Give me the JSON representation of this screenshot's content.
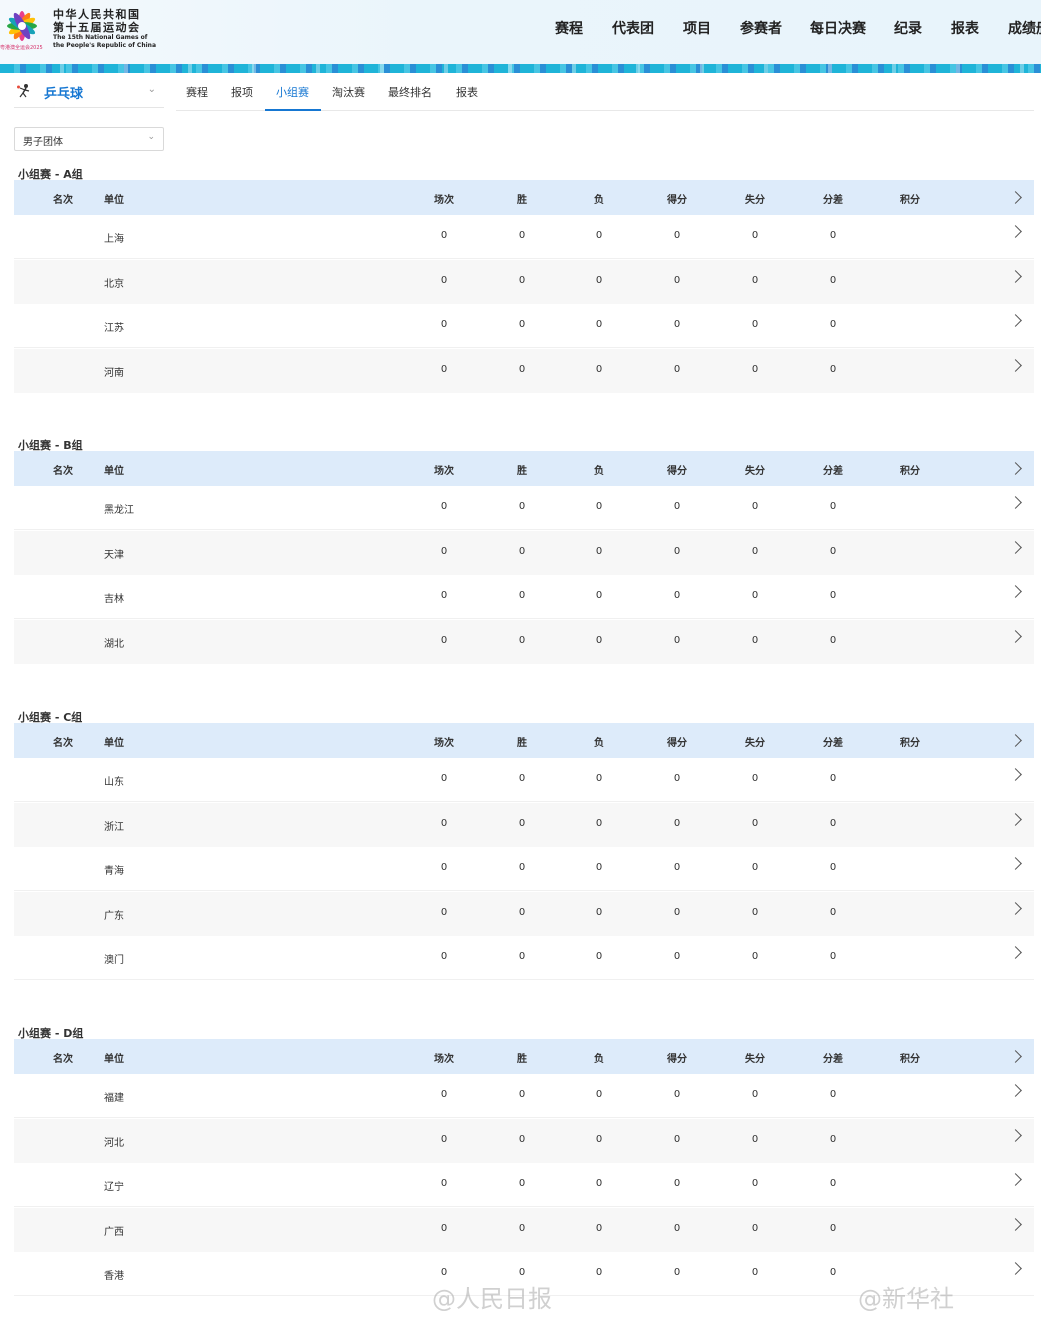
{
  "header": {
    "logo_cn_line1": "中华人民共和国",
    "logo_cn_line2": "第十五届运动会",
    "logo_en_line1": "The 15th National Games of",
    "logo_en_line2": "the People's Republic of China",
    "logo_sub": "粤港澳全运会2025",
    "nav": [
      "赛程",
      "代表团",
      "项目",
      "参赛者",
      "每日决赛",
      "纪录",
      "报表",
      "成绩册"
    ]
  },
  "sport": {
    "label": "乒乓球",
    "icon": "table-tennis-icon"
  },
  "tabs": [
    "赛程",
    "报项",
    "小组赛",
    "淘汰赛",
    "最终排名",
    "报表"
  ],
  "active_tab": "小组赛",
  "event_select": {
    "value": "男子团体"
  },
  "columns": [
    "名次",
    "单位",
    "场次",
    "胜",
    "负",
    "得分",
    "失分",
    "分差",
    "积分"
  ],
  "groups": [
    {
      "title": "小组赛 - A组",
      "rows": [
        {
          "rank": "",
          "team": "上海",
          "played": "0",
          "won": "0",
          "lost": "0",
          "scored": "0",
          "conceded": "0",
          "diff": "0",
          "points": ""
        },
        {
          "rank": "",
          "team": "北京",
          "played": "0",
          "won": "0",
          "lost": "0",
          "scored": "0",
          "conceded": "0",
          "diff": "0",
          "points": ""
        },
        {
          "rank": "",
          "team": "江苏",
          "played": "0",
          "won": "0",
          "lost": "0",
          "scored": "0",
          "conceded": "0",
          "diff": "0",
          "points": ""
        },
        {
          "rank": "",
          "team": "河南",
          "played": "0",
          "won": "0",
          "lost": "0",
          "scored": "0",
          "conceded": "0",
          "diff": "0",
          "points": ""
        }
      ]
    },
    {
      "title": "小组赛 - B组",
      "rows": [
        {
          "rank": "",
          "team": "黑龙江",
          "played": "0",
          "won": "0",
          "lost": "0",
          "scored": "0",
          "conceded": "0",
          "diff": "0",
          "points": ""
        },
        {
          "rank": "",
          "team": "天津",
          "played": "0",
          "won": "0",
          "lost": "0",
          "scored": "0",
          "conceded": "0",
          "diff": "0",
          "points": ""
        },
        {
          "rank": "",
          "team": "吉林",
          "played": "0",
          "won": "0",
          "lost": "0",
          "scored": "0",
          "conceded": "0",
          "diff": "0",
          "points": ""
        },
        {
          "rank": "",
          "team": "湖北",
          "played": "0",
          "won": "0",
          "lost": "0",
          "scored": "0",
          "conceded": "0",
          "diff": "0",
          "points": ""
        }
      ]
    },
    {
      "title": "小组赛 - C组",
      "rows": [
        {
          "rank": "",
          "team": "山东",
          "played": "0",
          "won": "0",
          "lost": "0",
          "scored": "0",
          "conceded": "0",
          "diff": "0",
          "points": ""
        },
        {
          "rank": "",
          "team": "浙江",
          "played": "0",
          "won": "0",
          "lost": "0",
          "scored": "0",
          "conceded": "0",
          "diff": "0",
          "points": ""
        },
        {
          "rank": "",
          "team": "青海",
          "played": "0",
          "won": "0",
          "lost": "0",
          "scored": "0",
          "conceded": "0",
          "diff": "0",
          "points": ""
        },
        {
          "rank": "",
          "team": "广东",
          "played": "0",
          "won": "0",
          "lost": "0",
          "scored": "0",
          "conceded": "0",
          "diff": "0",
          "points": ""
        },
        {
          "rank": "",
          "team": "澳门",
          "played": "0",
          "won": "0",
          "lost": "0",
          "scored": "0",
          "conceded": "0",
          "diff": "0",
          "points": ""
        }
      ]
    },
    {
      "title": "小组赛 - D组",
      "rows": [
        {
          "rank": "",
          "team": "福建",
          "played": "0",
          "won": "0",
          "lost": "0",
          "scored": "0",
          "conceded": "0",
          "diff": "0",
          "points": ""
        },
        {
          "rank": "",
          "team": "河北",
          "played": "0",
          "won": "0",
          "lost": "0",
          "scored": "0",
          "conceded": "0",
          "diff": "0",
          "points": ""
        },
        {
          "rank": "",
          "team": "辽宁",
          "played": "0",
          "won": "0",
          "lost": "0",
          "scored": "0",
          "conceded": "0",
          "diff": "0",
          "points": ""
        },
        {
          "rank": "",
          "team": "广西",
          "played": "0",
          "won": "0",
          "lost": "0",
          "scored": "0",
          "conceded": "0",
          "diff": "0",
          "points": ""
        },
        {
          "rank": "",
          "team": "香港",
          "played": "0",
          "won": "0",
          "lost": "0",
          "scored": "0",
          "conceded": "0",
          "diff": "0",
          "points": ""
        }
      ]
    }
  ],
  "watermarks": [
    "@人民日报",
    "@新华社"
  ],
  "colors": {
    "accent": "#1677d2",
    "header_row": "#ddebfa",
    "stripe": "#1fb4d8"
  }
}
